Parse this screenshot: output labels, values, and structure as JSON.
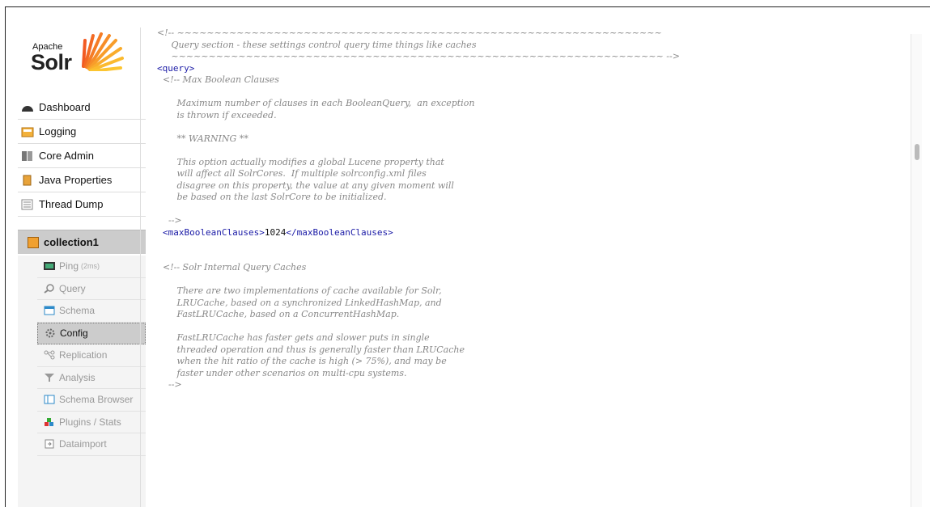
{
  "logo": {
    "apache": "Apache",
    "solr": "Solr"
  },
  "nav": [
    {
      "label": "Dashboard",
      "icon": "dashboard-icon"
    },
    {
      "label": "Logging",
      "icon": "logging-icon"
    },
    {
      "label": "Core Admin",
      "icon": "core-admin-icon"
    },
    {
      "label": "Java Properties",
      "icon": "java-properties-icon"
    },
    {
      "label": "Thread Dump",
      "icon": "thread-dump-icon"
    }
  ],
  "core": {
    "label": "collection1"
  },
  "subnav": [
    {
      "label": "Ping",
      "extra": "(2ms)"
    },
    {
      "label": "Query"
    },
    {
      "label": "Schema"
    },
    {
      "label": "Config"
    },
    {
      "label": "Replication"
    },
    {
      "label": "Analysis"
    },
    {
      "label": "Schema Browser"
    },
    {
      "label": "Plugins / Stats"
    },
    {
      "label": "Dataimport"
    }
  ],
  "code": {
    "l1": "<!-- ~~~~~~~~~~~~~~~~~~~~~~~~~~~~~~~~~~~~~~~~~~~~~~~~~~~~~~~~~~~~~~~~~",
    "l2": "     Query section - these settings control query time things like caches",
    "l3": "     ~~~~~~~~~~~~~~~~~~~~~~~~~~~~~~~~~~~~~~~~~~~~~~~~~~~~~~~~~~~~~~~~~~ -->",
    "l4": "<query>",
    "l5": "  <!-- Max Boolean Clauses",
    "l6": "",
    "l7": "       Maximum number of clauses in each BooleanQuery,  an exception",
    "l8": "       is thrown if exceeded.",
    "l9": "",
    "l10": "       ** WARNING **",
    "l11": "",
    "l12": "       This option actually modifies a global Lucene property that",
    "l13": "       will affect all SolrCores.  If multiple solrconfig.xml files",
    "l14": "       disagree on this property, the value at any given moment will",
    "l15": "       be based on the last SolrCore to be initialized.",
    "l16": "",
    "l17": "    -->",
    "l18a": "<maxBooleanClauses>",
    "l18b": "1024",
    "l18c": "</maxBooleanClauses>",
    "l19": "",
    "l20": "",
    "l21": "  <!-- Solr Internal Query Caches",
    "l22": "",
    "l23": "       There are two implementations of cache available for Solr,",
    "l24": "       LRUCache, based on a synchronized LinkedHashMap, and",
    "l25": "       FastLRUCache, based on a ConcurrentHashMap.",
    "l26": "",
    "l27": "       FastLRUCache has faster gets and slower puts in single",
    "l28": "       threaded operation and thus is generally faster than LRUCache",
    "l29": "       when the hit ratio of the cache is high (> 75%), and may be",
    "l30": "       faster under other scenarios on multi-cpu systems.",
    "l31": "    -->"
  }
}
